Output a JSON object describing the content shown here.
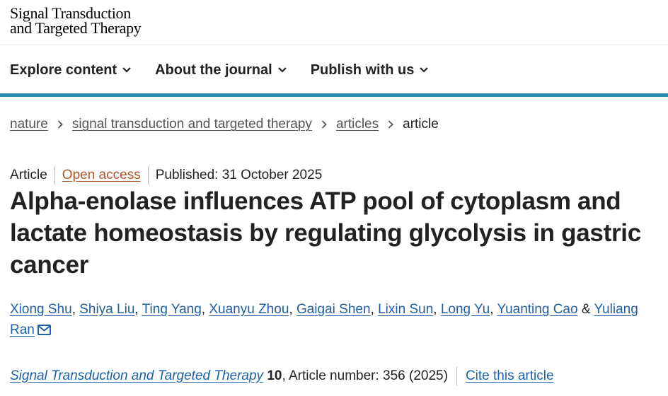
{
  "header": {
    "journal_logo_line1": "Signal Transduction",
    "journal_logo_line2": "and Targeted Therapy"
  },
  "nav": {
    "items": [
      {
        "label": "Explore content",
        "icon": "chevron-down-icon"
      },
      {
        "label": "About the journal",
        "icon": "chevron-down-icon"
      },
      {
        "label": "Publish with us",
        "icon": "chevron-down-icon"
      }
    ],
    "accent_color": "#2a8ab0"
  },
  "breadcrumb": {
    "items": [
      "nature",
      "signal transduction and targeted therapy",
      "articles"
    ],
    "current": "article"
  },
  "article": {
    "type": "Article",
    "access": "Open access",
    "published": "Published: 31 October 2025",
    "title": "Alpha-enolase influences ATP pool of cytoplasm and lactate homeostasis by regulating glycolysis in gastric cancer",
    "authors": [
      "Xiong Shu",
      "Shiya Liu",
      "Ting Yang",
      "Xuanyu Zhou",
      "Gaigai Shen",
      "Lixin Sun",
      "Long Yu",
      "Yuanting Cao",
      "Yuliang Ran"
    ],
    "author_separator": ", ",
    "author_last_separator": " & ",
    "corresponding_icon": "mail-icon"
  },
  "citation": {
    "journal": "Signal Transduction and Targeted Therapy",
    "volume": "10",
    "rest": ", Article number: 356 (2025)",
    "cite_label": "Cite this article"
  },
  "colors": {
    "link": "#1e5fa8",
    "open_access": "#b25428",
    "text": "#222222"
  }
}
